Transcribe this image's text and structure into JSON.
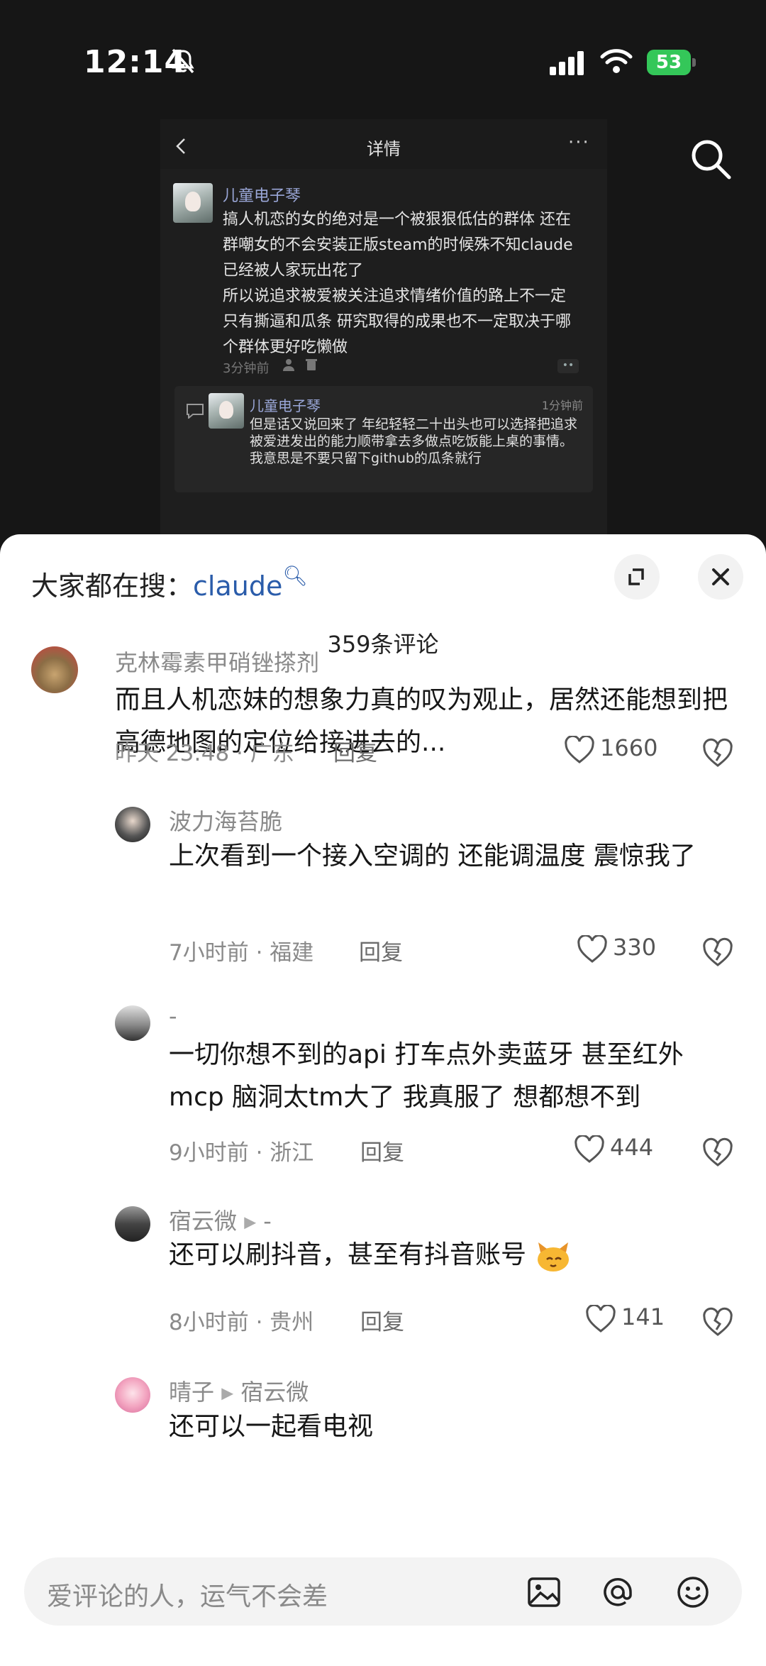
{
  "status_bar": {
    "time": "12:14",
    "battery": "53"
  },
  "screenshot": {
    "title": "详情",
    "more": "···",
    "post": {
      "author": "儿童电子琴",
      "text": "搞人机恋的女的绝对是一个被狠狠低估的群体 还在群嘲女的不会安装正版steam的时候殊不知claude已经被人家玩出花了\n所以说追求被爱被关注追求情绪价值的路上不一定只有撕逼和瓜条 研究取得的成果也不一定取决于哪个群体更好吃懒做",
      "time": "3分钟前",
      "dots": "••"
    },
    "reply": {
      "author": "儿童电子琴",
      "time": "1分钟前",
      "text": "但是话又说回来了 年纪轻轻二十出头也可以选择把追求被爱进发出的能力顺带拿去多做点吃饭能上桌的事情。我意思是不要只留下github的瓜条就行"
    }
  },
  "sheet": {
    "hot_search_prefix": "大家都在搜：",
    "hot_search_keyword": "claude",
    "comment_count": "359条评论",
    "reply_label": "回复",
    "comments": [
      {
        "name": "克林霉素甲硝锉搽剂",
        "text": "而且人机恋妹的想象力真的叹为观止，居然还能想到把高德地图的定位给接进去的...",
        "time": "昨天 23:48 · 广东",
        "likes": "1660"
      },
      {
        "name": "波力海苔脆",
        "text": "上次看到一个接入空调的 还能调温度 震惊我了",
        "time": "7小时前 · 福建",
        "likes": "330"
      },
      {
        "name": "-",
        "text": "一切你想不到的api 打车点外卖蓝牙 甚至红外mcp 脑洞太tm大了 我真服了 想都想不到",
        "time": "9小时前 · 浙江",
        "likes": "444"
      },
      {
        "name": "宿云微",
        "reply_to": "-",
        "text": "还可以刷抖音，甚至有抖音账号",
        "time": "8小时前 · 贵州",
        "likes": "141"
      },
      {
        "name": "晴子",
        "reply_to": "宿云微",
        "text": "还可以一起看电视"
      }
    ],
    "input_placeholder": "爱评论的人，运气不会差"
  }
}
